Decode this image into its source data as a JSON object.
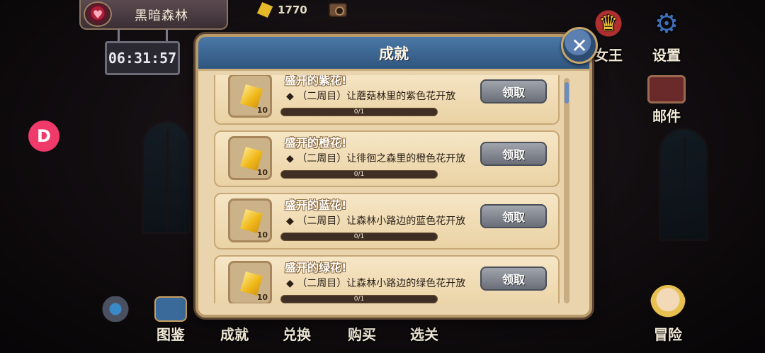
{
  "location": {
    "name": "黑暗森林",
    "timer": "06:31:57"
  },
  "currency": {
    "gems": "1770"
  },
  "side_menu": {
    "queen_label": "女王",
    "settings_label": "设置",
    "mail_label": "邮件"
  },
  "bottom_menu": {
    "codex_label": "图鉴",
    "achievements_label": "成就",
    "exchange_label": "兑换",
    "shop_label": "购买",
    "stage_select_label": "选关",
    "adventure_label": "冒险"
  },
  "modal": {
    "title": "成就",
    "close_glyph": "✕",
    "items": [
      {
        "title": "盛开的紫花!",
        "desc": "◆ （二周目）让蘑菇林里的紫色花开放",
        "reward": "10",
        "progress_text": "0/1",
        "progress": 0,
        "claim_label": "领取"
      },
      {
        "title": "盛开的橙花!",
        "desc": "◆ （二周目）让徘徊之森里的橙色花开放",
        "reward": "10",
        "progress_text": "0/1",
        "progress": 0,
        "claim_label": "领取"
      },
      {
        "title": "盛开的蓝花!",
        "desc": "◆ （二周目）让森林小路边的蓝色花开放",
        "reward": "10",
        "progress_text": "0/1",
        "progress": 0,
        "claim_label": "领取"
      },
      {
        "title": "盛开的绿花!",
        "desc": "◆ （二周目）让森林小路边的绿色花开放",
        "reward": "10",
        "progress_text": "0/1",
        "progress": 0,
        "claim_label": "领取"
      }
    ]
  },
  "colors": {
    "header_blue": "#3d6a98",
    "parchment": "#e9d4ad",
    "gem_gold": "#f0b81a",
    "claim_gray": "#8a8e96"
  }
}
